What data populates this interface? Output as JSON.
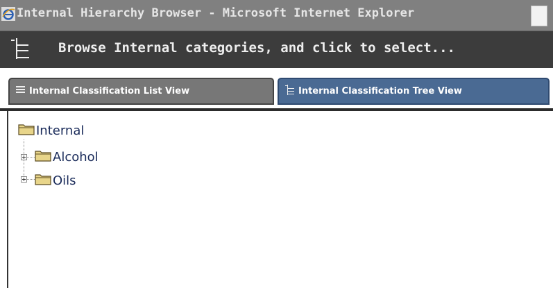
{
  "window": {
    "title": "Internal Hierarchy Browser - Microsoft Internet Explorer",
    "icon": "internet-explorer-icon"
  },
  "header": {
    "text": "Browse Internal categories, and click to select...",
    "icon": "tree-view-icon"
  },
  "tabs": [
    {
      "label": "Internal Classification List View",
      "icon": "list-icon",
      "active": false
    },
    {
      "label": "Internal Classification Tree View",
      "icon": "tree-icon",
      "active": true
    }
  ],
  "tree": {
    "root": {
      "label": "Internal",
      "icon": "folder-icon"
    },
    "children": [
      {
        "label": "Alcohol",
        "icon": "folder-icon",
        "expandable": true
      },
      {
        "label": "Oils",
        "icon": "folder-icon",
        "expandable": true
      }
    ]
  },
  "colors": {
    "titlebar": "#808080",
    "header": "#3c3c3c",
    "tab_inactive": "#777777",
    "tab_active": "#4a6a93",
    "tree_text": "#1a2b5a",
    "folder": "#e8d58a"
  }
}
